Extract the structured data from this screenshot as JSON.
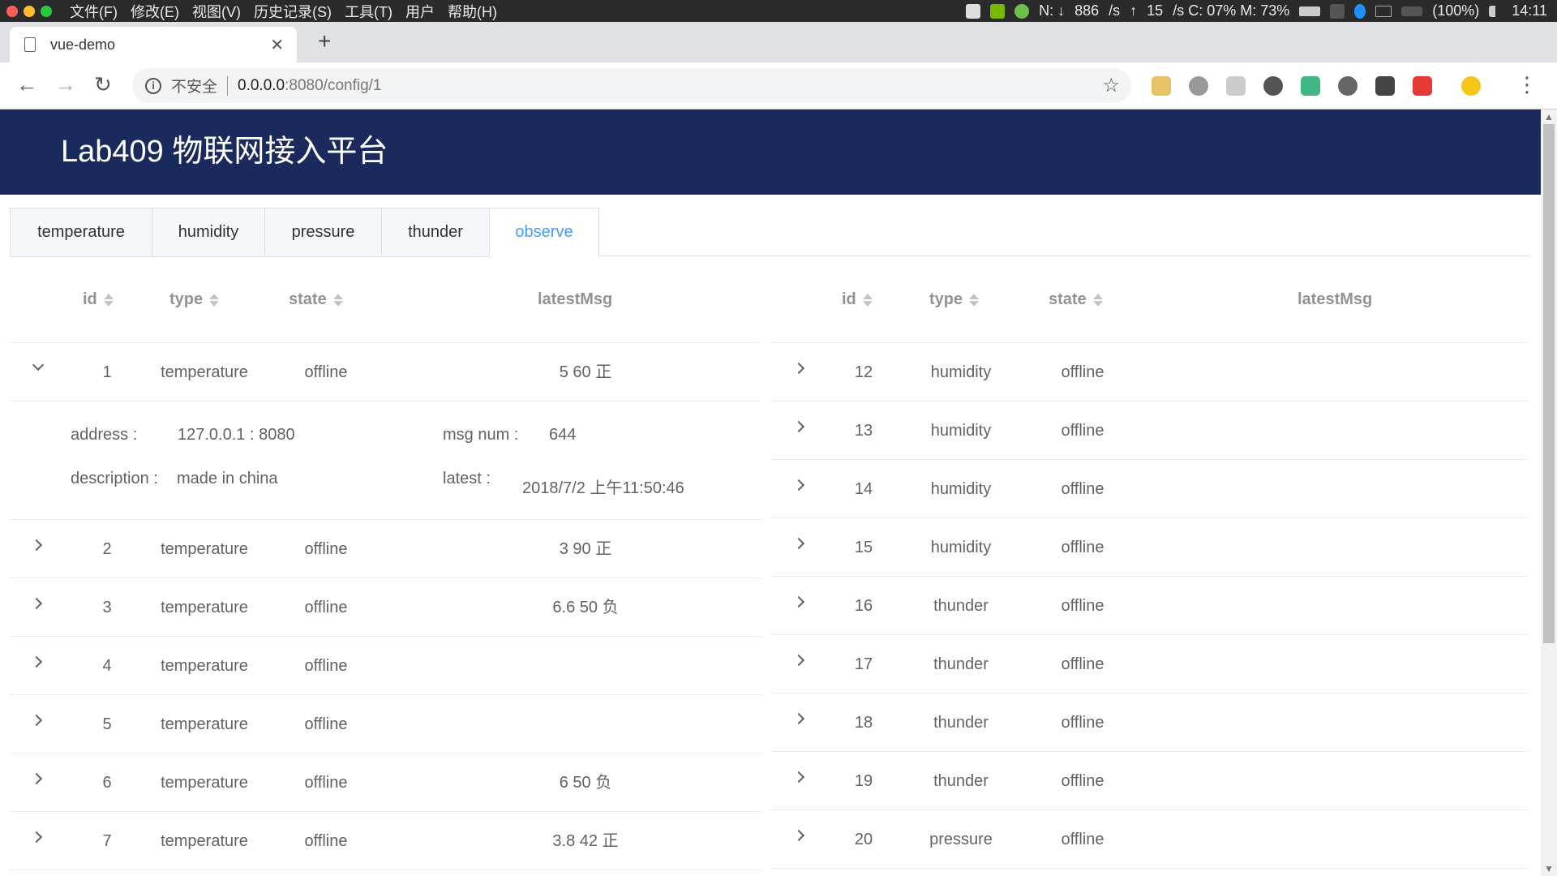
{
  "os": {
    "menu": [
      "文件(F)",
      "修改(E)",
      "视图(V)",
      "历史记录(S)",
      "工具(T)",
      "用户",
      "帮助(H)"
    ],
    "net_down_label": "N: ↓",
    "net_down": "886",
    "net_down_unit": "/s",
    "net_up_label": "↑",
    "net_up": "15",
    "cpu_mem": "/s C: 07% M: 73%",
    "battery": "(100%)",
    "time": "14:11"
  },
  "browser": {
    "tab_title": "vue-demo",
    "close_glyph": "✕",
    "new_tab_glyph": "+",
    "security_label": "不安全",
    "url_host": "0.0.0.0",
    "url_path": ":8080/config/1",
    "back_glyph": "←",
    "forward_glyph": "→",
    "reload_glyph": "↻",
    "star_glyph": "☆",
    "menu_glyph": "⋮",
    "info_glyph": "i"
  },
  "app": {
    "title": "Lab409 物联网接入平台",
    "tabs": [
      "temperature",
      "humidity",
      "pressure",
      "thunder",
      "observe"
    ],
    "active_tab": "observe"
  },
  "columns": {
    "id": "id",
    "type": "type",
    "state": "state",
    "latest": "latestMsg"
  },
  "left_rows": [
    {
      "id": "1",
      "type": "temperature",
      "state": "offline",
      "latest": "5 60 正"
    },
    {
      "id": "2",
      "type": "temperature",
      "state": "offline",
      "latest": "3 90 正"
    },
    {
      "id": "3",
      "type": "temperature",
      "state": "offline",
      "latest": "6.6 50 负"
    },
    {
      "id": "4",
      "type": "temperature",
      "state": "offline",
      "latest": ""
    },
    {
      "id": "5",
      "type": "temperature",
      "state": "offline",
      "latest": ""
    },
    {
      "id": "6",
      "type": "temperature",
      "state": "offline",
      "latest": "6 50 负"
    },
    {
      "id": "7",
      "type": "temperature",
      "state": "offline",
      "latest": "3.8 42 正"
    }
  ],
  "expanded": {
    "address_label": "address :",
    "address": "127.0.0.1 : 8080",
    "msgnum_label": "msg num :",
    "msgnum": "644",
    "description_label": "description :",
    "description": "made in china",
    "latest_label": "latest :",
    "latest": "2018/7/2 上午11:50:46"
  },
  "right_rows": [
    {
      "id": "12",
      "type": "humidity",
      "state": "offline",
      "latest": ""
    },
    {
      "id": "13",
      "type": "humidity",
      "state": "offline",
      "latest": ""
    },
    {
      "id": "14",
      "type": "humidity",
      "state": "offline",
      "latest": ""
    },
    {
      "id": "15",
      "type": "humidity",
      "state": "offline",
      "latest": ""
    },
    {
      "id": "16",
      "type": "thunder",
      "state": "offline",
      "latest": ""
    },
    {
      "id": "17",
      "type": "thunder",
      "state": "offline",
      "latest": ""
    },
    {
      "id": "18",
      "type": "thunder",
      "state": "offline",
      "latest": ""
    },
    {
      "id": "19",
      "type": "thunder",
      "state": "offline",
      "latest": ""
    },
    {
      "id": "20",
      "type": "pressure",
      "state": "offline",
      "latest": ""
    }
  ],
  "colors": {
    "header_bg": "#1b2a5c",
    "active_tab": "#409eff"
  }
}
